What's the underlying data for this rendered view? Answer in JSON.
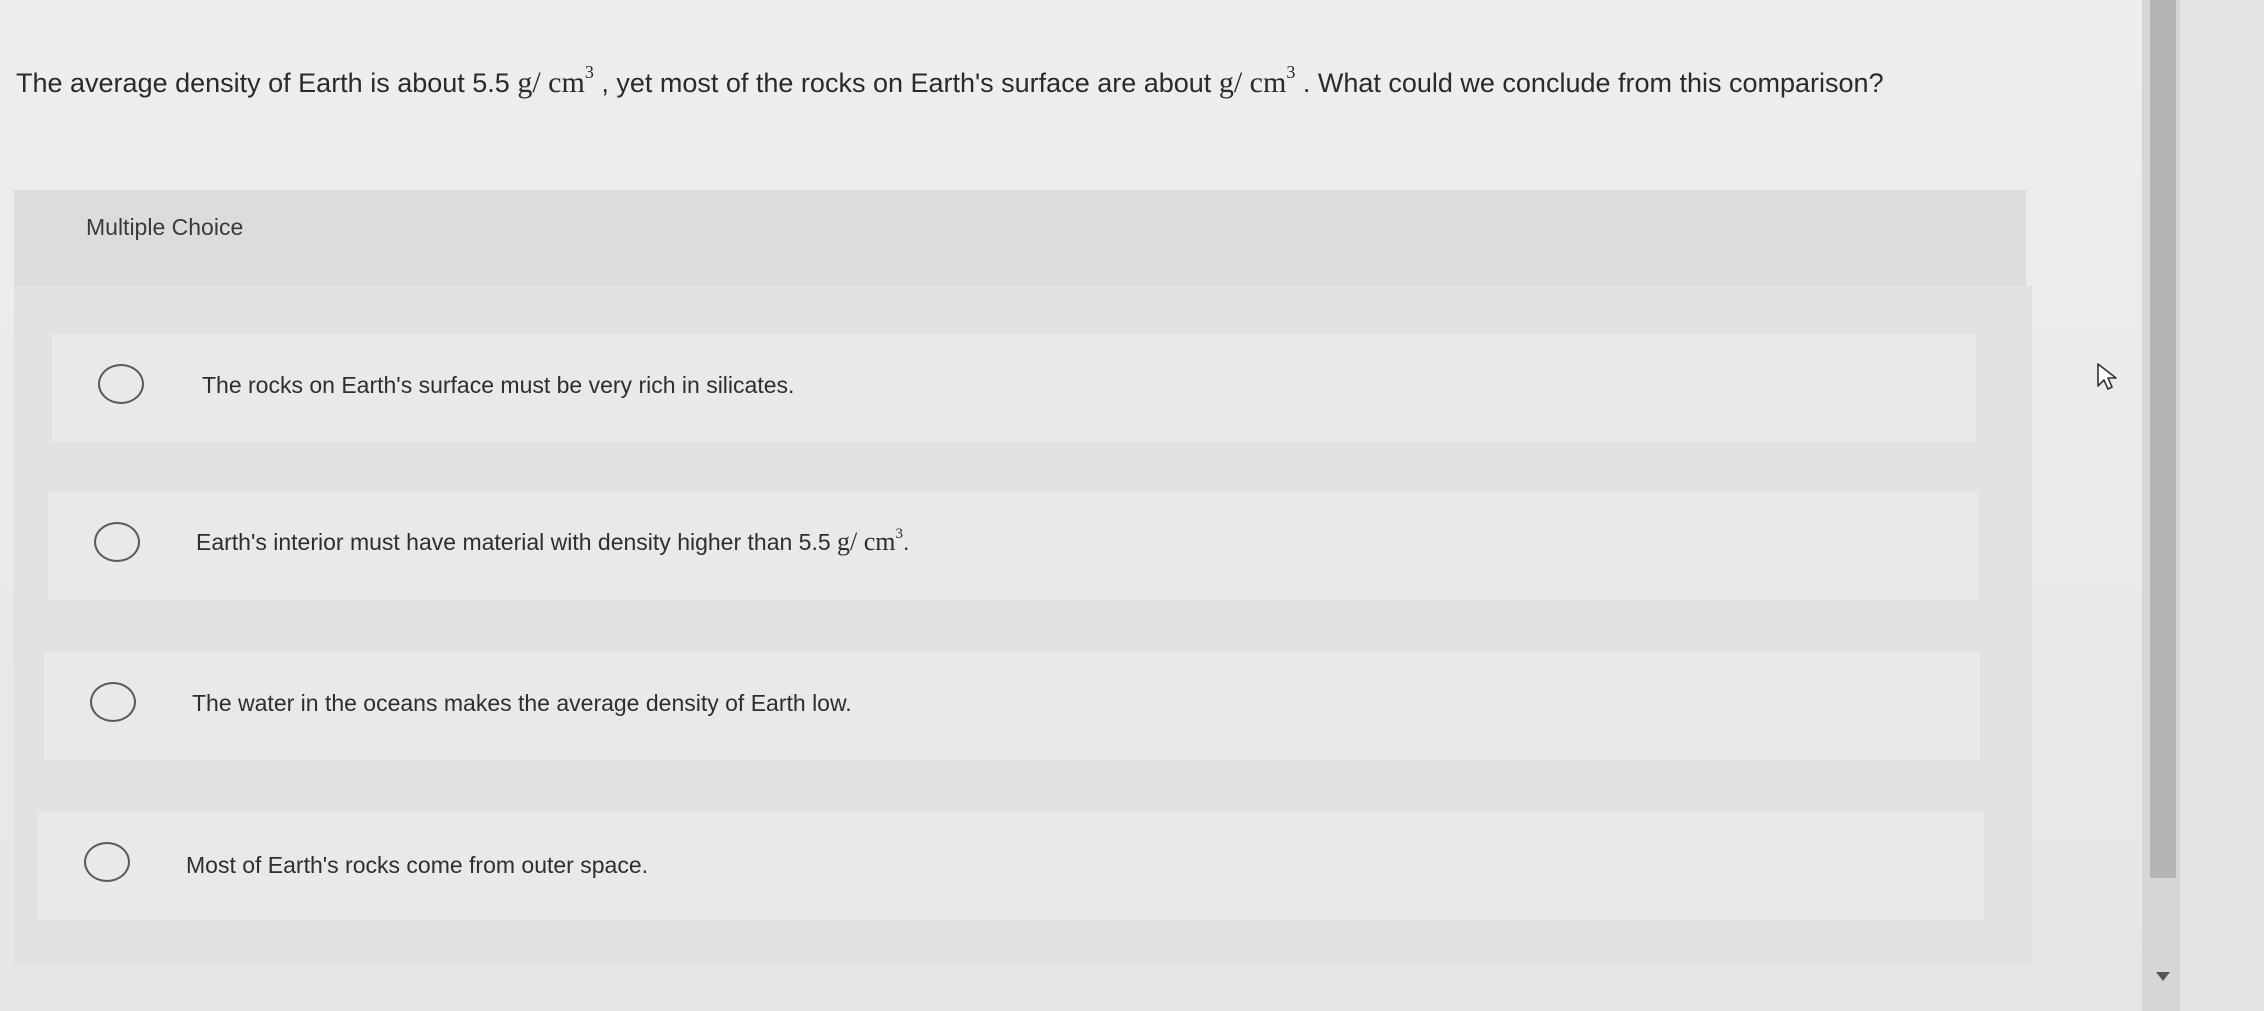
{
  "question": {
    "part1": "The average density of Earth is about 5.5",
    "unit1": "g/ cm",
    "exp1": "3",
    "part2": ", yet most of the rocks on Earth's surface are about",
    "unit2": "g/ cm",
    "exp2": "3",
    "part3": ". What could we conclude from this comparison?"
  },
  "section": {
    "label": "Multiple Choice"
  },
  "choices": [
    {
      "text": "The rocks on Earth's surface must be very rich in silicates."
    },
    {
      "text": "Earth's interior must have material with density higher than 5.5",
      "unit": "g/ cm",
      "exp": "3",
      "suffix": "."
    },
    {
      "text": "The water in the oceans makes the average density of Earth low."
    },
    {
      "text": "Most of Earth's rocks come from outer space."
    }
  ],
  "colors": {
    "background": "#ececec",
    "header": "#dcdcdc",
    "choice": "#e9e9e9",
    "radio_border": "#5a5a5a"
  },
  "icons": [
    "radio-unselected-icon",
    "cursor-arrow-icon",
    "scroll-down-arrow-icon"
  ]
}
